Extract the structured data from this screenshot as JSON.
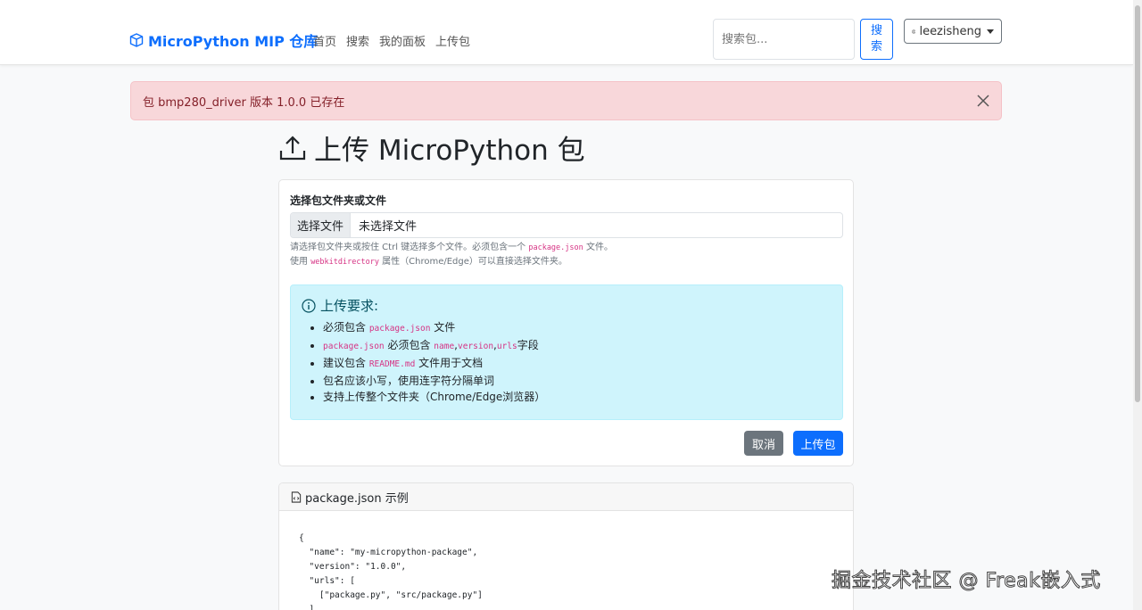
{
  "navbar": {
    "brand": "MicroPython MIP 仓库",
    "links": [
      "首页",
      "搜索",
      "我的面板",
      "上传包"
    ],
    "search_placeholder": "搜索包...",
    "search_button": "搜索",
    "user": "leezisheng"
  },
  "alert": {
    "message": "包 bmp280_driver 版本 1.0.0 已存在"
  },
  "page_title": "上传 MicroPython 包",
  "upload_form": {
    "label": "选择包文件夹或文件",
    "choose_button": "选择文件",
    "no_file_text": "未选择文件",
    "help_line1_a": "请选择包文件夹或按住 Ctrl 键选择多个文件。必须包含一个 ",
    "help_line1_code": "package.json",
    "help_line1_b": " 文件。",
    "help_line2_a": "使用 ",
    "help_line2_code": "webkitdirectory",
    "help_line2_b": " 属性（Chrome/Edge）可以直接选择文件夹。",
    "requirements_title": "上传要求:",
    "requirements": [
      {
        "pre": "必须包含 ",
        "code": "package.json",
        "post": " 文件"
      },
      {
        "pre": "",
        "code": "package.json",
        "post": " 必须包含 ",
        "code2": "name",
        "sep1": ",",
        "code3": "version",
        "sep2": ",",
        "code4": "urls",
        "post2": "字段"
      },
      {
        "pre": "建议包含 ",
        "code": "README.md",
        "post": " 文件用于文档"
      },
      {
        "pre": "包名应该小写，使用连字符分隔单词",
        "code": "",
        "post": ""
      },
      {
        "pre": "支持上传整个文件夹（Chrome/Edge浏览器）",
        "code": "",
        "post": ""
      }
    ],
    "cancel_button": "取消",
    "upload_button": "上传包"
  },
  "example": {
    "title": "package.json 示例",
    "code": "{\n  \"name\": \"my-micropython-package\",\n  \"version\": \"1.0.0\",\n  \"urls\": [\n    [\"package.py\", \"src/package.py\"]\n  ],"
  },
  "watermark": "掘金技术社区 @ Freak嵌入式",
  "colors": {
    "primary": "#0d6efd",
    "danger_bg": "#f8d7da",
    "info_bg": "#cff4fc",
    "secondary": "#6c757d"
  }
}
